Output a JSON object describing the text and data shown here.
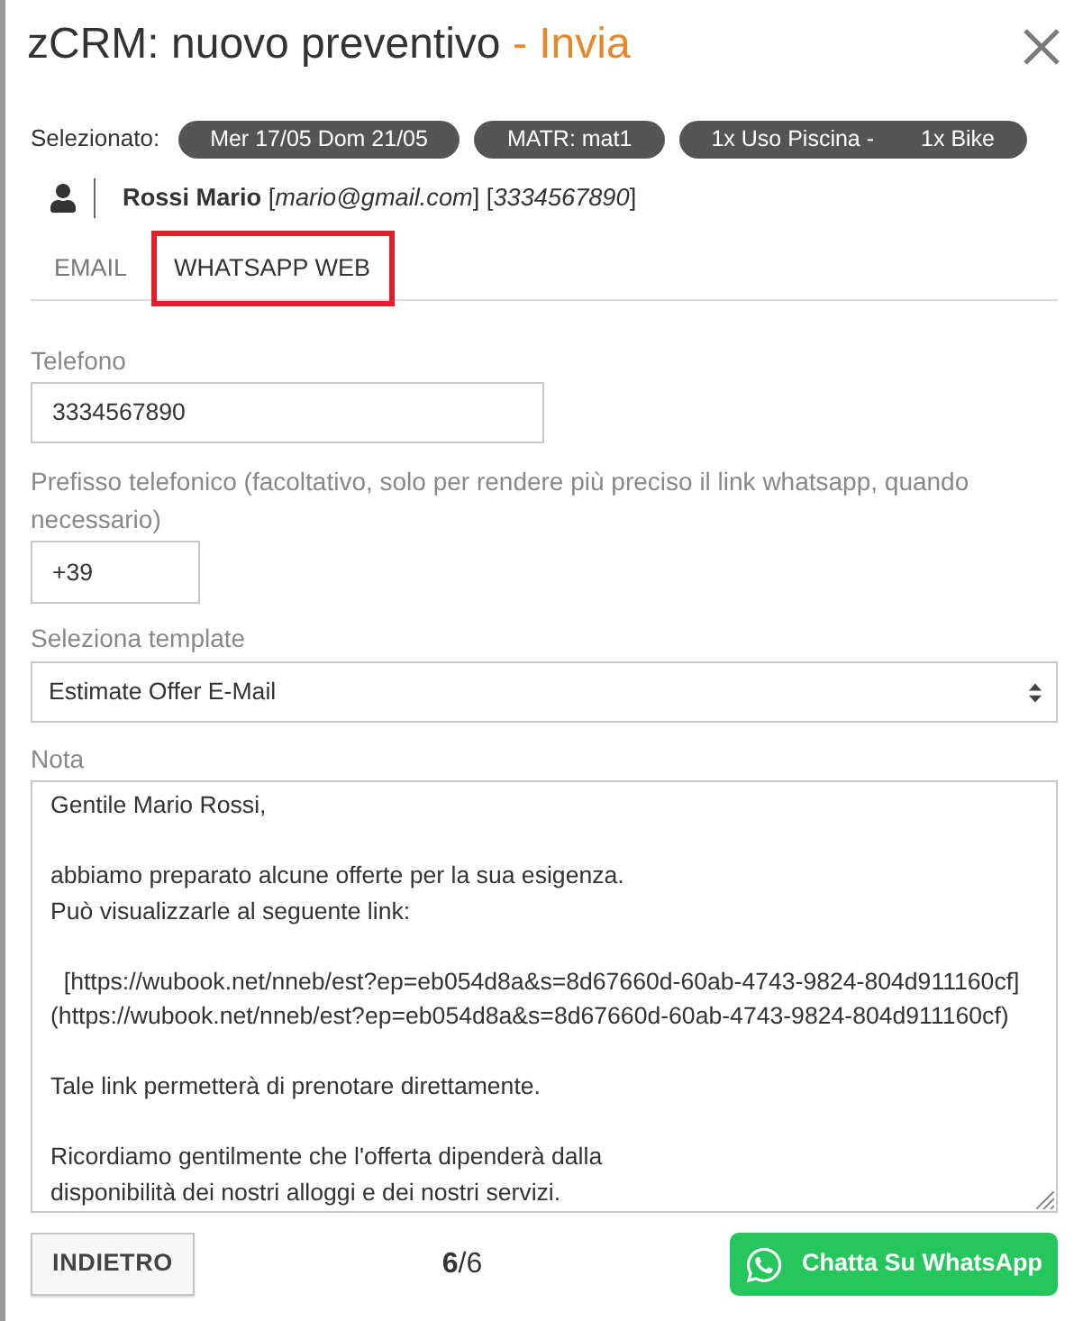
{
  "dialog": {
    "title": "zCRM: nuovo preventivo",
    "title_suffix": "- Invia"
  },
  "selection": {
    "label": "Selezionato:",
    "chips": [
      {
        "parts": [
          "Mer 17/05 Dom 21/05"
        ]
      },
      {
        "parts": [
          "MATR: mat1"
        ]
      },
      {
        "parts": [
          "1x Uso Piscina -",
          "1x Bike"
        ]
      }
    ]
  },
  "customer": {
    "text": "**Rossi Mario** [*mario@gmail.com*] [*3334567890*]"
  },
  "tabs": [
    {
      "label": "EMAIL",
      "selected": false
    },
    {
      "label": "WHATSAPP WEB",
      "selected": true
    }
  ],
  "phone": {
    "label": "Telefono",
    "value": "3334567890"
  },
  "prefix": {
    "label": "Prefisso telefonico (facoltativo, solo per rendere più preciso il link whatsapp, quando necessario)",
    "value": "+39"
  },
  "template": {
    "label": "Seleziona template",
    "value": "Estimate Offer E-Mail"
  },
  "note": {
    "label": "Nota",
    "value": "Gentile Mario Rossi,\n\nabbiamo preparato alcune offerte per la sua esigenza.\nPuò visualizzarle al seguente link:\n\n  [https://wubook.net/nneb/est?ep=eb054d8a&s=8d67660d-60ab-4743-9824-804d911160cf](https://wubook.net/nneb/est?ep=eb054d8a&s=8d67660d-60ab-4743-9824-804d911160cf)\n\nTale link permetterà di prenotare direttamente.\n\nRicordiamo gentilmente che l'offerta dipenderà dalla\ndisponibilità dei nostri alloggi e dei nostri servizi."
  },
  "footer": {
    "back_button": "INDIETRO",
    "pager": "**6**/6",
    "whatsapp_button": "Chatta Su WhatsApp"
  }
}
